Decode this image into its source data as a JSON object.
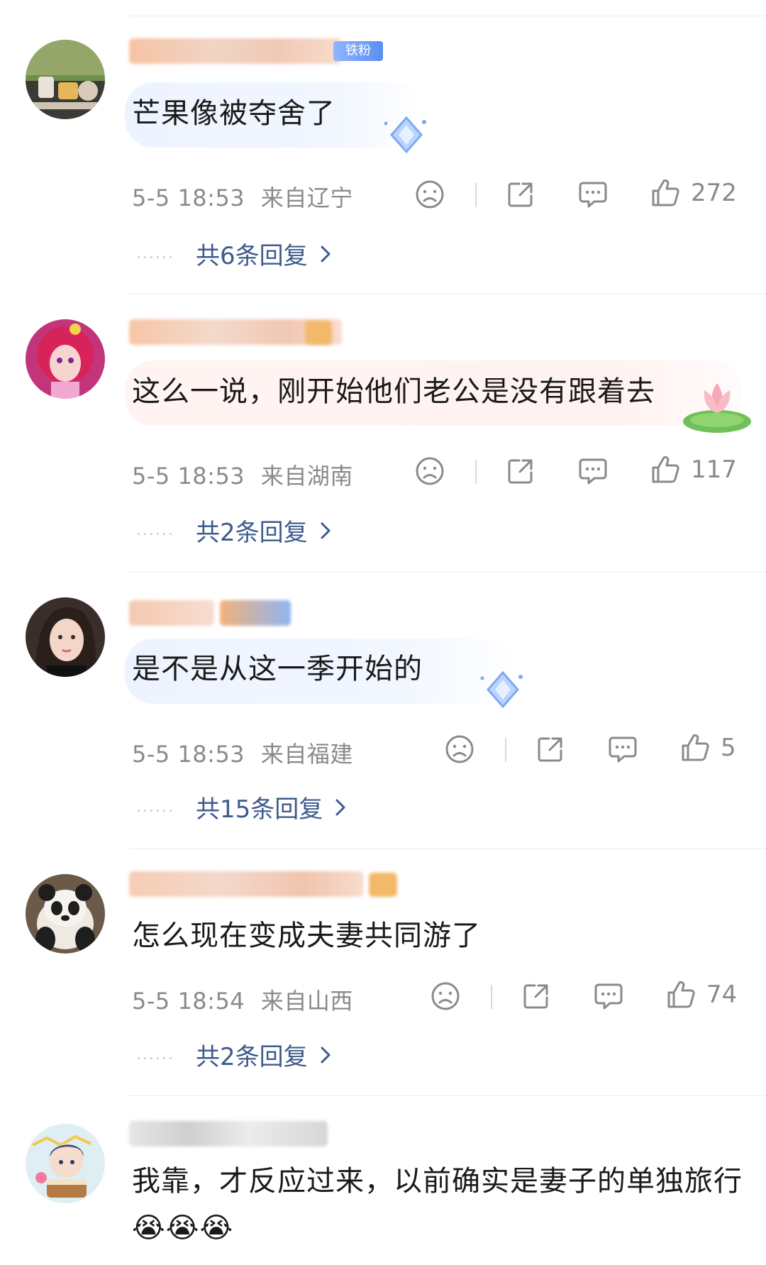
{
  "comments": [
    {
      "text": "芒果像被夺舍了",
      "time": "5-5 18:53",
      "location": "来自辽宁",
      "likes": "272",
      "reply_label": "共6条回复",
      "badge_text": "铁粉"
    },
    {
      "text": "这么一说，刚开始他们老公是没有跟着去",
      "time": "5-5 18:53",
      "location": "来自湖南",
      "likes": "117",
      "reply_label": "共2条回复"
    },
    {
      "text": "是不是从这一季开始的",
      "time": "5-5 18:53",
      "location": "来自福建",
      "likes": "5",
      "reply_label": "共15条回复"
    },
    {
      "text": "怎么现在变成夫妻共同游了",
      "time": "5-5 18:54",
      "location": "来自山西",
      "likes": "74",
      "reply_label": "共2条回复"
    },
    {
      "text": "我靠，才反应过来，以前确实是妻子的单独旅行😭😭😭"
    }
  ],
  "icons": {
    "dislike": "sad-face-icon",
    "share": "share-icon",
    "comment": "comment-icon",
    "like": "thumbs-up-icon",
    "expand": "chevron-right-icon"
  },
  "colors": {
    "reply_link": "#3e5b8c",
    "meta_text": "#8a8a8a",
    "bubble_blue": "#eef4ff",
    "bubble_pink": "#fff4f2"
  }
}
